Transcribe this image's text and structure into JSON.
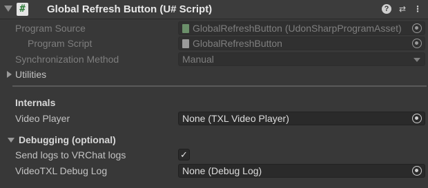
{
  "header": {
    "title": "Global Refresh Button (U# Script)",
    "script_icon_glyph": "#",
    "help_glyph": "?",
    "presets_glyph": "⇄",
    "more_glyph": "⋮"
  },
  "program_source": {
    "label": "Program Source",
    "value": "GlobalRefreshButton (UdonSharpProgramAsset)"
  },
  "program_script": {
    "label": "Program Script",
    "value": "GlobalRefreshButton"
  },
  "sync_method": {
    "label": "Synchronization Method",
    "value": "Manual"
  },
  "utilities": {
    "label": "Utilities"
  },
  "internals": {
    "heading": "Internals",
    "video_player_label": "Video Player",
    "video_player_value": "None (TXL Video Player)"
  },
  "debugging": {
    "heading": "Debugging (optional)",
    "send_logs_label": "Send logs to VRChat logs",
    "send_logs_checked": true,
    "check_glyph": "✓",
    "debug_log_label": "VideoTXL Debug Log",
    "debug_log_value": "None (Debug Log)"
  }
}
